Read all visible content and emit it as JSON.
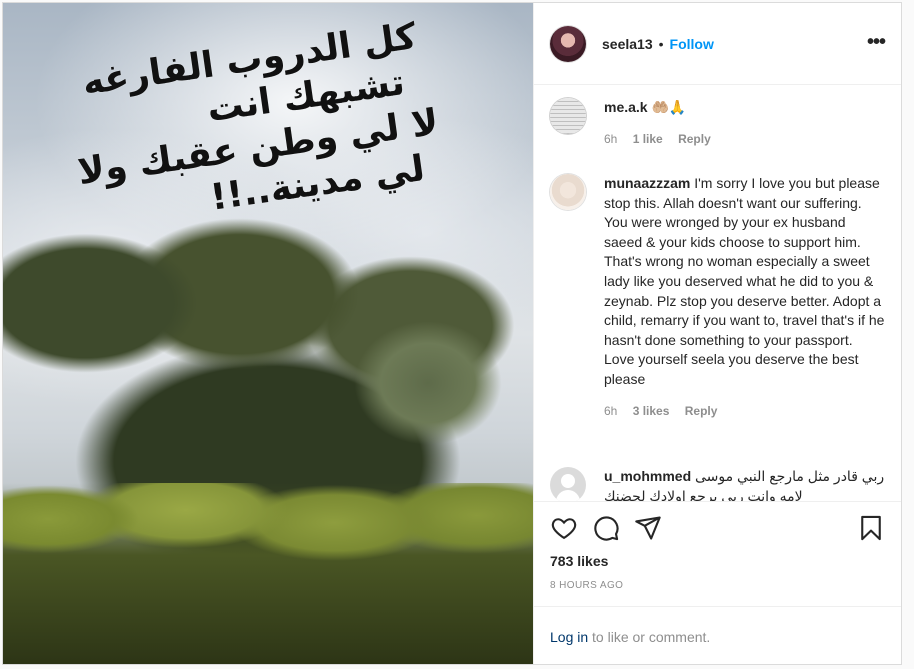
{
  "photo": {
    "overlay_lines": [
      "كل الدروب الفارغه",
      "تشبهك انت",
      "لا لي وطن عقبك ولا",
      "لي مدينة..!!"
    ]
  },
  "header": {
    "username": "seela13",
    "separator": "•",
    "follow_label": "Follow",
    "more_label": "•••"
  },
  "comments": [
    {
      "username": "me.a.k",
      "text": " 🤲🏼🙏",
      "time": "6h",
      "likes": "1 like",
      "reply": "Reply"
    },
    {
      "username": "munaazzzam",
      "text": " I'm sorry I love you but please stop this. Allah doesn't want our suffering. You were wronged by your ex husband saeed & your kids choose to support him. That's wrong no woman especially a sweet lady like you deserved what he did to you & zeynab. Plz stop you deserve better. Adopt a child, remarry if you want to, travel that's if he hasn't done something to your passport. Love yourself seela you deserve the best please",
      "time": "6h",
      "likes": "3 likes",
      "reply": "Reply"
    },
    {
      "username": "u_mohmmed",
      "text": " ربي قادر مثل مارجع النبي موسى لامه وانت ربي يرجع اولادك لحضنك",
      "time": "",
      "likes": "",
      "reply": ""
    }
  ],
  "actions": {
    "likes": "783 likes",
    "timestamp": "8 HOURS AGO",
    "login_link": "Log in",
    "login_suffix": " to like or comment."
  }
}
